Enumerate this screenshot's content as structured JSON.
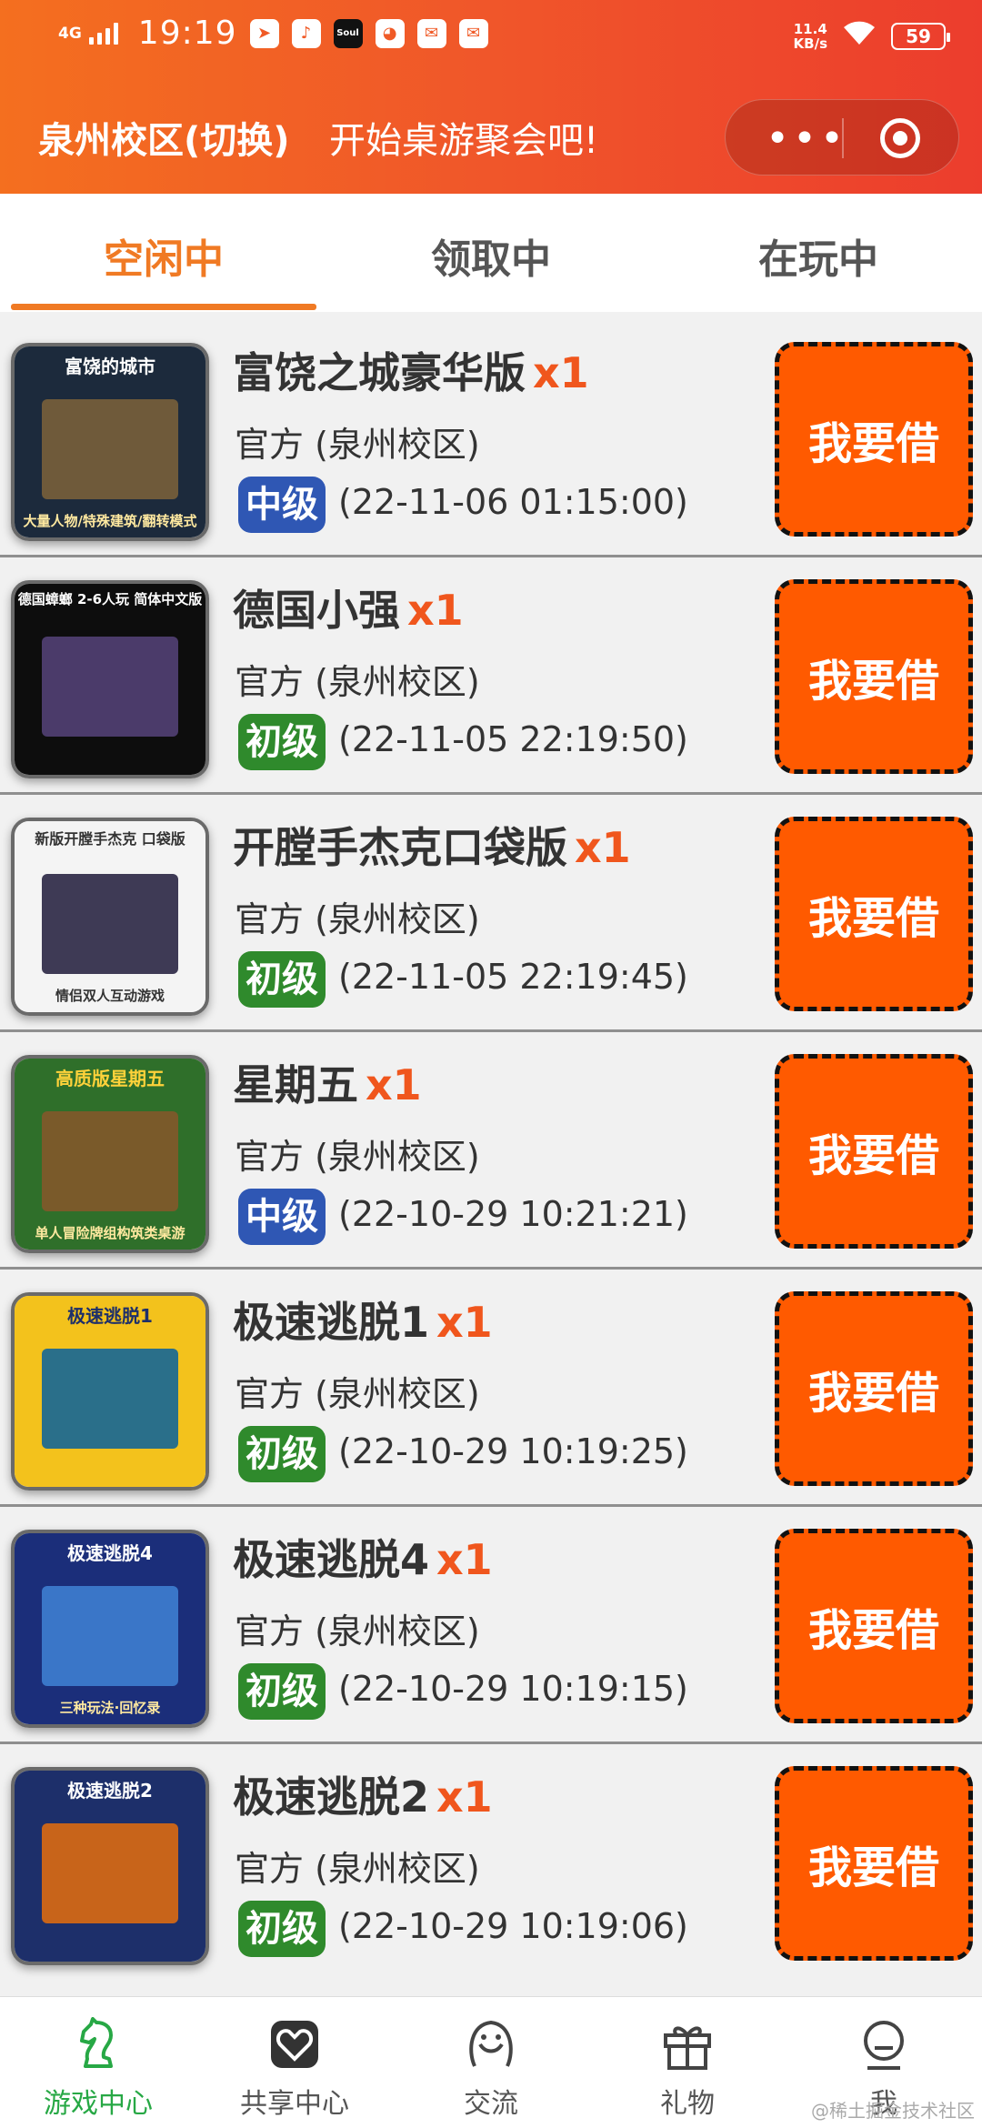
{
  "status_bar": {
    "network": "4G",
    "time": "19:19",
    "apps": [
      "telegram-icon",
      "tiktok-icon",
      "soul-icon",
      "bilibili-icon",
      "mail-icon",
      "mail-icon"
    ],
    "soul_label": "Soul",
    "speed_value": "11.4",
    "speed_unit": "KB/s",
    "battery": "59"
  },
  "header": {
    "campus": "泉州校区(切换)",
    "slogan": "开始桌游聚会吧!",
    "more_glyph": "•••",
    "accent_color": "#f05a26"
  },
  "tabs": [
    {
      "label": "空闲中",
      "active": true
    },
    {
      "label": "领取中",
      "active": false
    },
    {
      "label": "在玩中",
      "active": false
    }
  ],
  "borrow_label": "我要借",
  "games": [
    {
      "title": "富饶之城豪华版",
      "qty": "x1",
      "owner": "官方 (泉州校区)",
      "level": "中级",
      "level_type": "mid",
      "time": "(22-11-06 01:15:00)",
      "thumb": {
        "caption": "富饶的城市",
        "subcaption": "大量人物/特殊建筑/翻转模式",
        "bg": "#1c2a3c",
        "art": "#6f5a3a"
      }
    },
    {
      "title": "德国小强",
      "qty": "x1",
      "owner": "官方 (泉州校区)",
      "level": "初级",
      "level_type": "low",
      "time": "(22-11-05 22:19:50)",
      "thumb": {
        "caption": "德国蟑螂 2-6人玩 简体中文版",
        "subcaption": "",
        "bg": "#0d0d0d",
        "art": "#4b3b6a"
      }
    },
    {
      "title": "开膛手杰克口袋版",
      "qty": "x1",
      "owner": "官方 (泉州校区)",
      "level": "初级",
      "level_type": "low",
      "time": "(22-11-05 22:19:45)",
      "thumb": {
        "caption": "新版开膛手杰克 口袋版",
        "subcaption": "情侣双人互动游戏",
        "bg": "#f4f4f4",
        "art": "#3e3a55"
      }
    },
    {
      "title": "星期五",
      "qty": "x1",
      "owner": "官方 (泉州校区)",
      "level": "中级",
      "level_type": "mid",
      "time": "(22-10-29 10:21:21)",
      "thumb": {
        "caption": "高质版星期五",
        "subcaption": "单人冒险牌组构筑类桌游",
        "bg": "#2f6f2a",
        "art": "#7a5a2a"
      }
    },
    {
      "title": "极速逃脱1",
      "qty": "x1",
      "owner": "官方 (泉州校区)",
      "level": "初级",
      "level_type": "low",
      "time": "(22-10-29 10:19:25)",
      "thumb": {
        "caption": "极速逃脱1",
        "subcaption": "",
        "bg": "#f3c21c",
        "art": "#2a6f8a"
      }
    },
    {
      "title": "极速逃脱4",
      "qty": "x1",
      "owner": "官方 (泉州校区)",
      "level": "初级",
      "level_type": "low",
      "time": "(22-10-29 10:19:15)",
      "thumb": {
        "caption": "极速逃脱4",
        "subcaption": "三种玩法·回忆录",
        "bg": "#1b2e7a",
        "art": "#3a76c8"
      }
    },
    {
      "title": "极速逃脱2",
      "qty": "x1",
      "owner": "官方 (泉州校区)",
      "level": "初级",
      "level_type": "low",
      "time": "(22-10-29 10:19:06)",
      "thumb": {
        "caption": "极速逃脱2",
        "subcaption": "",
        "bg": "#1d2f6a",
        "art": "#c8641a"
      }
    }
  ],
  "bottom_nav": [
    {
      "label": "游戏中心",
      "icon": "chess-knight-icon",
      "active": true
    },
    {
      "label": "共享中心",
      "icon": "heart-box-icon",
      "active": false
    },
    {
      "label": "交流",
      "icon": "chat-face-icon",
      "active": false
    },
    {
      "label": "礼物",
      "icon": "gift-icon",
      "active": false
    },
    {
      "label": "我",
      "icon": "user-icon",
      "active": false
    }
  ],
  "watermark": "@稀土掘金技术社区"
}
